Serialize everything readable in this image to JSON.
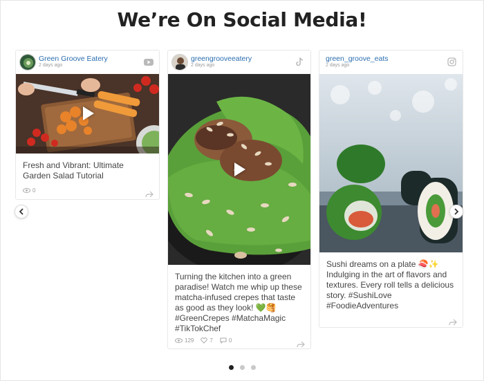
{
  "header": {
    "title": "We’re On Social Media!"
  },
  "posts": [
    {
      "username": "Green Groove Eatery",
      "time": "2 days ago",
      "platform_icon": "youtube-icon",
      "caption": "Fresh and Vibrant: Ultimate Garden Salad Tutorial",
      "views": "0"
    },
    {
      "username": "greengrooveeatery",
      "time": "2 days ago",
      "platform_icon": "tiktok-icon",
      "caption": "Turning the kitchen into a green paradise! Watch me whip up these matcha-infused crepes that taste as good as they look! 💚🥞 #GreenCrepes #MatchaMagic #TikTokChef",
      "views": "129",
      "likes": "7",
      "comments": "0"
    },
    {
      "username": "green_groove_eats",
      "time": "2 days ago",
      "platform_icon": "instagram-icon",
      "caption": "Sushi dreams on a plate 🍣✨ Indulging in the art of flavors and textures. Every roll tells a delicious story. #SushiLove #FoodieAdventures"
    }
  ],
  "carousel": {
    "pages": 3,
    "active_page": 1
  },
  "colors": {
    "link": "#2a6db0",
    "muted": "#999999",
    "dot_active": "#222222",
    "dot_inactive": "#c9c9c9"
  }
}
